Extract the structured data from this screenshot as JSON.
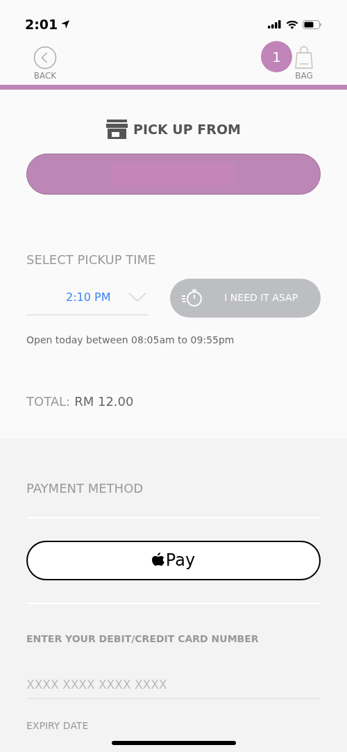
{
  "status_bar": {
    "time": "2:01"
  },
  "nav": {
    "back_label": "BACK",
    "bag_label": "BAG",
    "bag_count": "1"
  },
  "pickup": {
    "heading": "PICK UP FROM"
  },
  "pickup_time": {
    "heading": "SELECT PICKUP TIME",
    "value": "2:10 PM",
    "asap_label": "I NEED IT ASAP",
    "asap_selected": false,
    "hours_note": "Open today between 08:05am to 09:55pm"
  },
  "total": {
    "label": "TOTAL:",
    "amount": "RM 12.00"
  },
  "payment": {
    "heading": "PAYMENT METHOD",
    "apple_pay_label": "Pay",
    "card_heading": "ENTER YOUR DEBIT/CREDIT CARD NUMBER",
    "card_placeholder": "XXXX XXXX XXXX XXXX",
    "expiry_label": "EXPIRY DATE"
  }
}
